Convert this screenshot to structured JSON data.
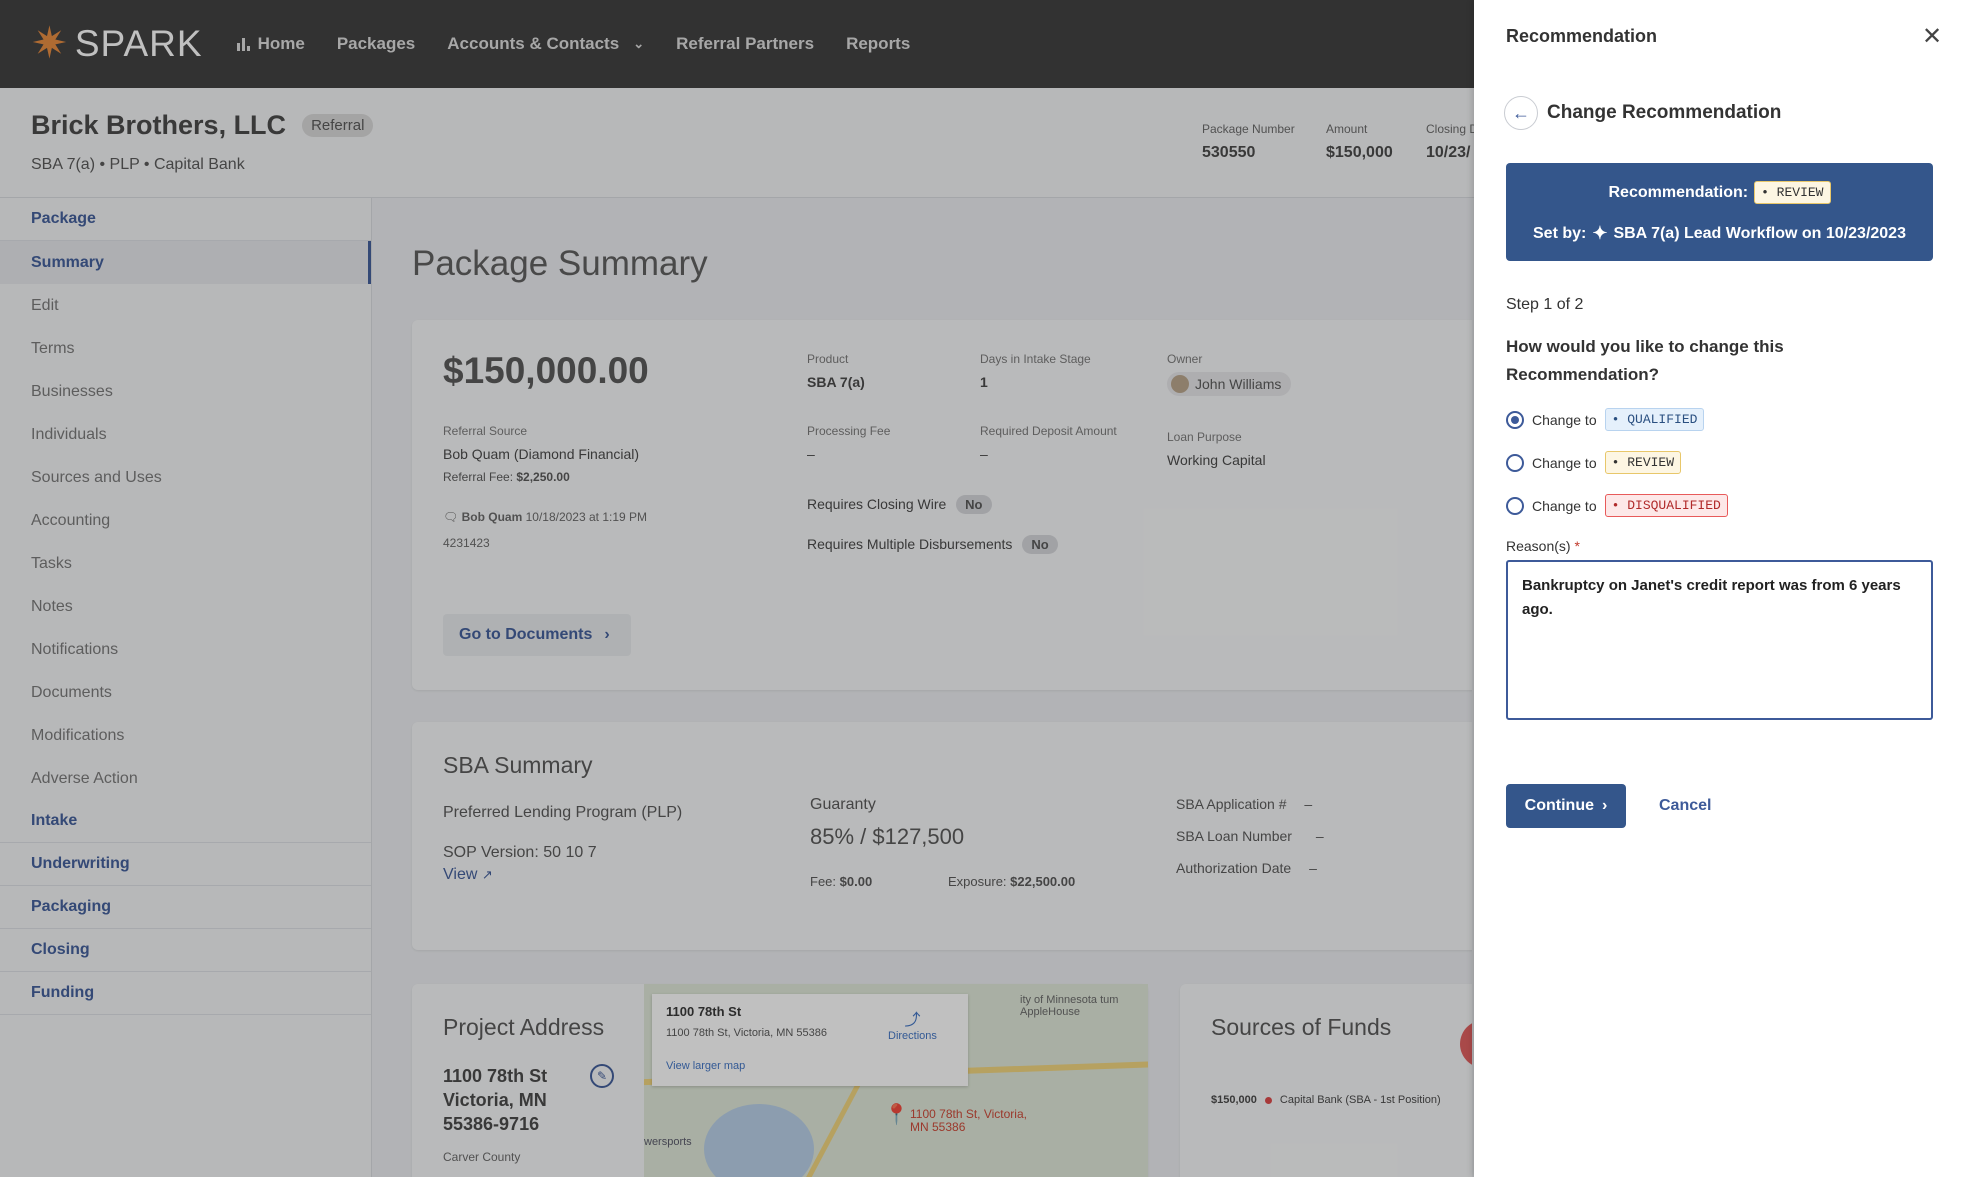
{
  "nav": {
    "logo": "SPARK",
    "items": [
      "Home",
      "Packages",
      "Accounts & Contacts",
      "Referral Partners",
      "Reports"
    ]
  },
  "header": {
    "company": "Brick Brothers, LLC",
    "badge": "Referral",
    "subline": "SBA 7(a) • PLP • Capital Bank",
    "package_number_label": "Package Number",
    "package_number": "530550",
    "amount_label": "Amount",
    "amount": "$150,000",
    "closing_label": "Closing D",
    "closing": "10/23/"
  },
  "sidebar": {
    "items": [
      {
        "label": "Package",
        "kind": "section"
      },
      {
        "label": "Summary",
        "kind": "active"
      },
      {
        "label": "Edit",
        "kind": "item"
      },
      {
        "label": "Terms",
        "kind": "item"
      },
      {
        "label": "Businesses",
        "kind": "item"
      },
      {
        "label": "Individuals",
        "kind": "item"
      },
      {
        "label": "Sources and Uses",
        "kind": "item"
      },
      {
        "label": "Accounting",
        "kind": "item"
      },
      {
        "label": "Tasks",
        "kind": "item"
      },
      {
        "label": "Notes",
        "kind": "item"
      },
      {
        "label": "Notifications",
        "kind": "item"
      },
      {
        "label": "Documents",
        "kind": "item"
      },
      {
        "label": "Modifications",
        "kind": "item"
      },
      {
        "label": "Adverse Action",
        "kind": "item"
      },
      {
        "label": "Intake",
        "kind": "section"
      },
      {
        "label": "Underwriting",
        "kind": "section"
      },
      {
        "label": "Packaging",
        "kind": "section"
      },
      {
        "label": "Closing",
        "kind": "section"
      },
      {
        "label": "Funding",
        "kind": "section"
      }
    ]
  },
  "main": {
    "title": "Package Summary",
    "amount": "$150,000.00",
    "referral_source_label": "Referral Source",
    "referral_source": "Bob Quam (Diamond Financial)",
    "referral_fee_label": "Referral Fee:",
    "referral_fee": "$2,250.00",
    "note_author": "Bob Quam",
    "note_date": "10/18/2023 at 1:19 PM",
    "note_text": "4231423",
    "product_label": "Product",
    "product": "SBA 7(a)",
    "days_label": "Days in Intake Stage",
    "days": "1",
    "owner_label": "Owner",
    "owner": "John Williams",
    "processing_fee_label": "Processing Fee",
    "processing_fee": "–",
    "deposit_label": "Required Deposit Amount",
    "deposit": "–",
    "loan_purpose_label": "Loan Purpose",
    "loan_purpose": "Working Capital",
    "closing_wire_label": "Requires Closing Wire",
    "closing_wire": "No",
    "multi_disb_label": "Requires Multiple Disbursements",
    "multi_disb": "No",
    "go_docs": "Go to Documents",
    "sba_title": "SBA Summary",
    "program": "Preferred Lending Program (PLP)",
    "sop": "SOP Version: 50 10 7",
    "view": "View",
    "guaranty_label": "Guaranty",
    "guaranty": "85% / $127,500",
    "fee_label": "Fee:",
    "fee": "$0.00",
    "exposure_label": "Exposure:",
    "exposure": "$22,500.00",
    "sba_app_label": "SBA Application #",
    "sba_app": "–",
    "sba_loan_label": "SBA Loan Number",
    "sba_loan": "–",
    "auth_label": "Authorization Date",
    "auth": "–",
    "project_title": "Project Address",
    "addr1": "1100 78th St",
    "addr2": "Victoria, MN",
    "addr3": "55386-9716",
    "county": "Carver County",
    "map_title": "1100 78th St",
    "map_addr": "1100 78th St, Victoria, MN 55386",
    "map_directions": "Directions",
    "map_larger": "View larger map",
    "map_pin_label": "1100 78th St, Victoria, MN 55386",
    "map_area": "ity of Minnesota tum AppleHouse",
    "map_area2": "wersports",
    "sources_title": "Sources of Funds",
    "sources_amount": "$150,000",
    "sources_desc": "Capital Bank (SBA - 1st Position)"
  },
  "drawer": {
    "title": "Recommendation",
    "subtitle": "Change Recommendation",
    "rec_label": "Recommendation:",
    "rec_value": "• REVIEW",
    "set_by_label": "Set by:",
    "set_by_value": "SBA 7(a) Lead Workflow on 10/23/2023",
    "step": "Step 1 of 2",
    "question": "How would you like to change this Recommendation?",
    "change_to": "Change to",
    "options": [
      {
        "value": "• QUALIFIED",
        "selected": true
      },
      {
        "value": "• REVIEW",
        "selected": false
      },
      {
        "value": "• DISQUALIFIED",
        "selected": false
      }
    ],
    "reason_label": "Reason(s)",
    "reason_required": "*",
    "reason_text": "Bankruptcy on Janet's credit report was from 6 years ago.",
    "continue": "Continue",
    "cancel": "Cancel"
  }
}
